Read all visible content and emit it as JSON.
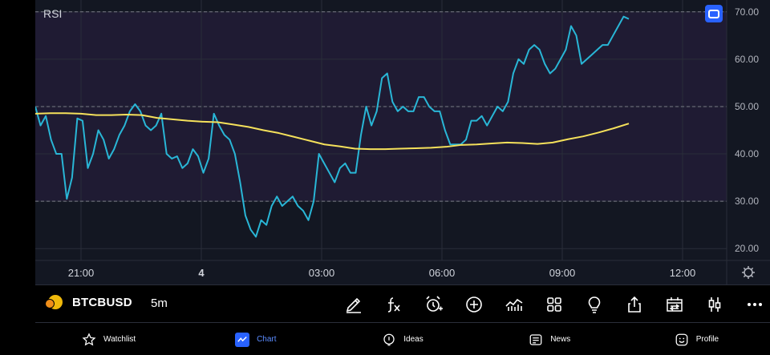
{
  "chart": {
    "indicator_label": "RSI",
    "colors": {
      "rsi_line": "#29b6d6",
      "ma_line": "#f5e15b",
      "background": "#131722",
      "grid": "#2a2e39",
      "level_line": "#787b86"
    },
    "chart_data": {
      "type": "line",
      "title": "",
      "y_ticks": [
        "70.00",
        "60.00",
        "50.00",
        "40.00",
        "30.00",
        "20.00"
      ],
      "ylim": [
        17.5,
        72.5
      ],
      "x_ticks": [
        "21:00",
        "4",
        "03:00",
        "06:00",
        "09:00",
        "12:00"
      ],
      "level_lines": [
        70,
        50,
        30
      ],
      "series": [
        {
          "values": [
            50,
            46,
            48,
            43,
            40,
            40,
            30.5,
            35,
            47.5,
            47,
            37,
            40,
            45,
            43,
            39,
            41,
            44,
            46,
            49,
            50.5,
            49,
            46,
            45,
            46,
            48.5,
            40,
            39,
            39.5,
            37,
            38,
            41,
            39.5,
            36,
            39,
            48.5,
            46,
            44,
            43,
            40,
            34,
            27,
            24,
            22.5,
            26,
            25,
            29,
            31,
            29,
            30,
            31,
            29,
            28,
            26,
            30,
            40,
            38,
            36,
            34,
            37,
            38,
            36,
            36,
            44,
            50,
            46,
            49,
            56,
            57,
            51,
            49,
            50,
            49,
            49,
            52,
            52,
            50,
            49,
            49,
            45,
            42,
            42,
            42,
            43,
            47,
            47,
            48,
            46,
            48,
            50,
            49,
            51,
            57,
            60,
            59,
            62,
            63,
            62,
            59,
            57,
            58,
            60,
            62,
            67,
            65,
            59,
            60,
            61,
            62,
            63,
            63,
            65,
            67,
            69,
            68.5
          ]
        },
        {
          "values": [
            48.5,
            48.6,
            48.6,
            48.5,
            48.2,
            48.2,
            48.3,
            48.2,
            47.6,
            47.3,
            47,
            46.8,
            46.7,
            46.2,
            45.7,
            45,
            44.4,
            43.6,
            42.8,
            42,
            41.6,
            41.1,
            41,
            41,
            41.1,
            41.2,
            41.3,
            41.5,
            41.9,
            42,
            42.2,
            42.4,
            42.3,
            42.1,
            42.4,
            43.1,
            43.7,
            44.5,
            45.4,
            46.4
          ]
        }
      ]
    }
  },
  "toolbar": {
    "symbol": "BTCBUSD",
    "interval": "5m",
    "tools": [
      "pen-icon",
      "function-icon",
      "alarm-add-icon",
      "plus-circle-icon",
      "indicators-chart-icon",
      "grid-icon",
      "lightbulb-icon",
      "share-icon",
      "calendar-swap-icon",
      "candles-icon",
      "more-icon"
    ]
  },
  "nav": {
    "watchlist": "Watchlist",
    "chart": "Chart",
    "ideas": "Ideas",
    "news": "News",
    "profile": "Profile"
  }
}
